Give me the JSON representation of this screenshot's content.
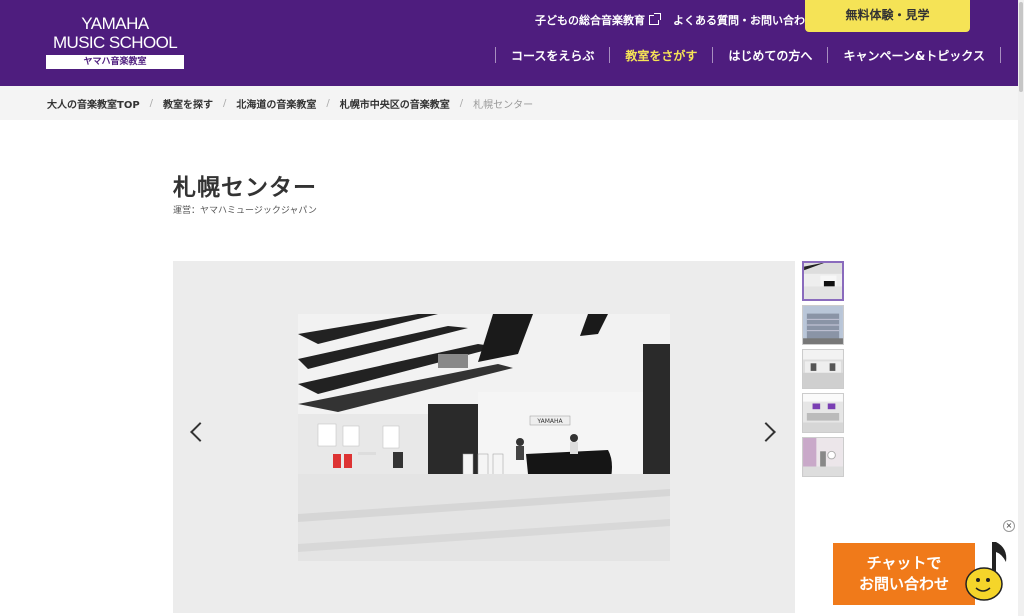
{
  "header": {
    "logo_line1": "YAMAHA",
    "logo_line2": "MUSIC SCHOOL",
    "logo_sub": "ヤマハ音楽教室",
    "util_links": [
      "子どもの総合音楽教育",
      "よくある質問・お問い合わせ"
    ],
    "cta_label": "無料体験・見学",
    "nav": [
      {
        "label": "コースをえらぶ",
        "active": false
      },
      {
        "label": "教室をさがす",
        "active": true
      },
      {
        "label": "はじめての方へ",
        "active": false
      },
      {
        "label": "キャンペーン&トピックス",
        "active": false
      }
    ],
    "brand_color": "#4e1d7e",
    "accent_color": "#f5e356"
  },
  "breadcrumb": [
    "大人の音楽教室TOP",
    "教室を探す",
    "北海道の音楽教室",
    "札幌市中央区の音楽教室",
    "札幌センター"
  ],
  "page": {
    "title": "札幌センター",
    "operator": "運営：ヤマハミュージックジャパン"
  },
  "gallery": {
    "prev_icon": "chevron-left-icon",
    "next_icon": "chevron-right-icon",
    "thumbnail_count": 5,
    "selected_index": 0,
    "photo_sign": "YAMAHA"
  },
  "chat": {
    "line1": "チャットで",
    "line2": "お問い合わせ",
    "color": "#f07a1a",
    "close_label": "×"
  }
}
